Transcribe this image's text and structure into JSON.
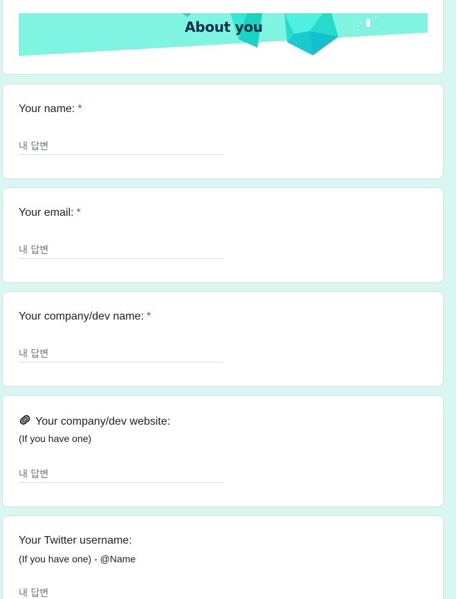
{
  "banner": {
    "title": "About you"
  },
  "questions": [
    {
      "title": "Your name:",
      "required_mark": "*",
      "placeholder": "내 답변"
    },
    {
      "title": "Your email:",
      "required_mark": "*",
      "placeholder": "내 답변"
    },
    {
      "title": "Your company/dev name:",
      "required_mark": "*",
      "placeholder": "내 답변"
    },
    {
      "icon": "paperclip-icon",
      "title": "Your company/dev website:",
      "subtitle": "(If you have one)",
      "placeholder": "내 답변"
    },
    {
      "title": "Your Twitter username:",
      "subtitle": "(If you have one) - @Name",
      "placeholder": "내 답변"
    }
  ],
  "colors": {
    "page_background": "#d8f7f3",
    "banner_teal": "#7ff5e1",
    "banner_title": "#0e2e4b",
    "required_red": "#d93025"
  }
}
